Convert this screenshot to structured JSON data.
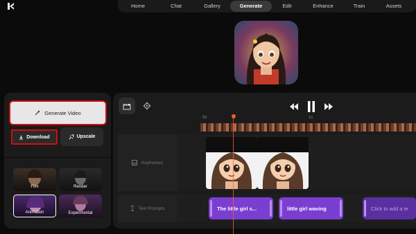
{
  "nav": {
    "items": [
      "Home",
      "Chat",
      "Gallery",
      "Generate",
      "Edit",
      "Enhance",
      "Train",
      "Assets"
    ],
    "active": "Generate"
  },
  "left_panel": {
    "generate_label": "Generate Video",
    "download_label": "Download",
    "upscale_label": "Upscale",
    "styles": [
      "Film",
      "Render",
      "Animation",
      "Experimental"
    ],
    "selected_style": "Animation"
  },
  "timeline": {
    "ruler": [
      "0s",
      "1s"
    ],
    "tracks": {
      "keyframes_label": "Keyframes",
      "prompts_label": "Text Prompts"
    },
    "prompts": [
      "The little girl s...",
      "little girl waving",
      "Click to add a te"
    ]
  },
  "colors": {
    "accent_red": "#d01010",
    "playhead": "#ff5a2a",
    "prompt_purple": "#7a3fd0"
  }
}
